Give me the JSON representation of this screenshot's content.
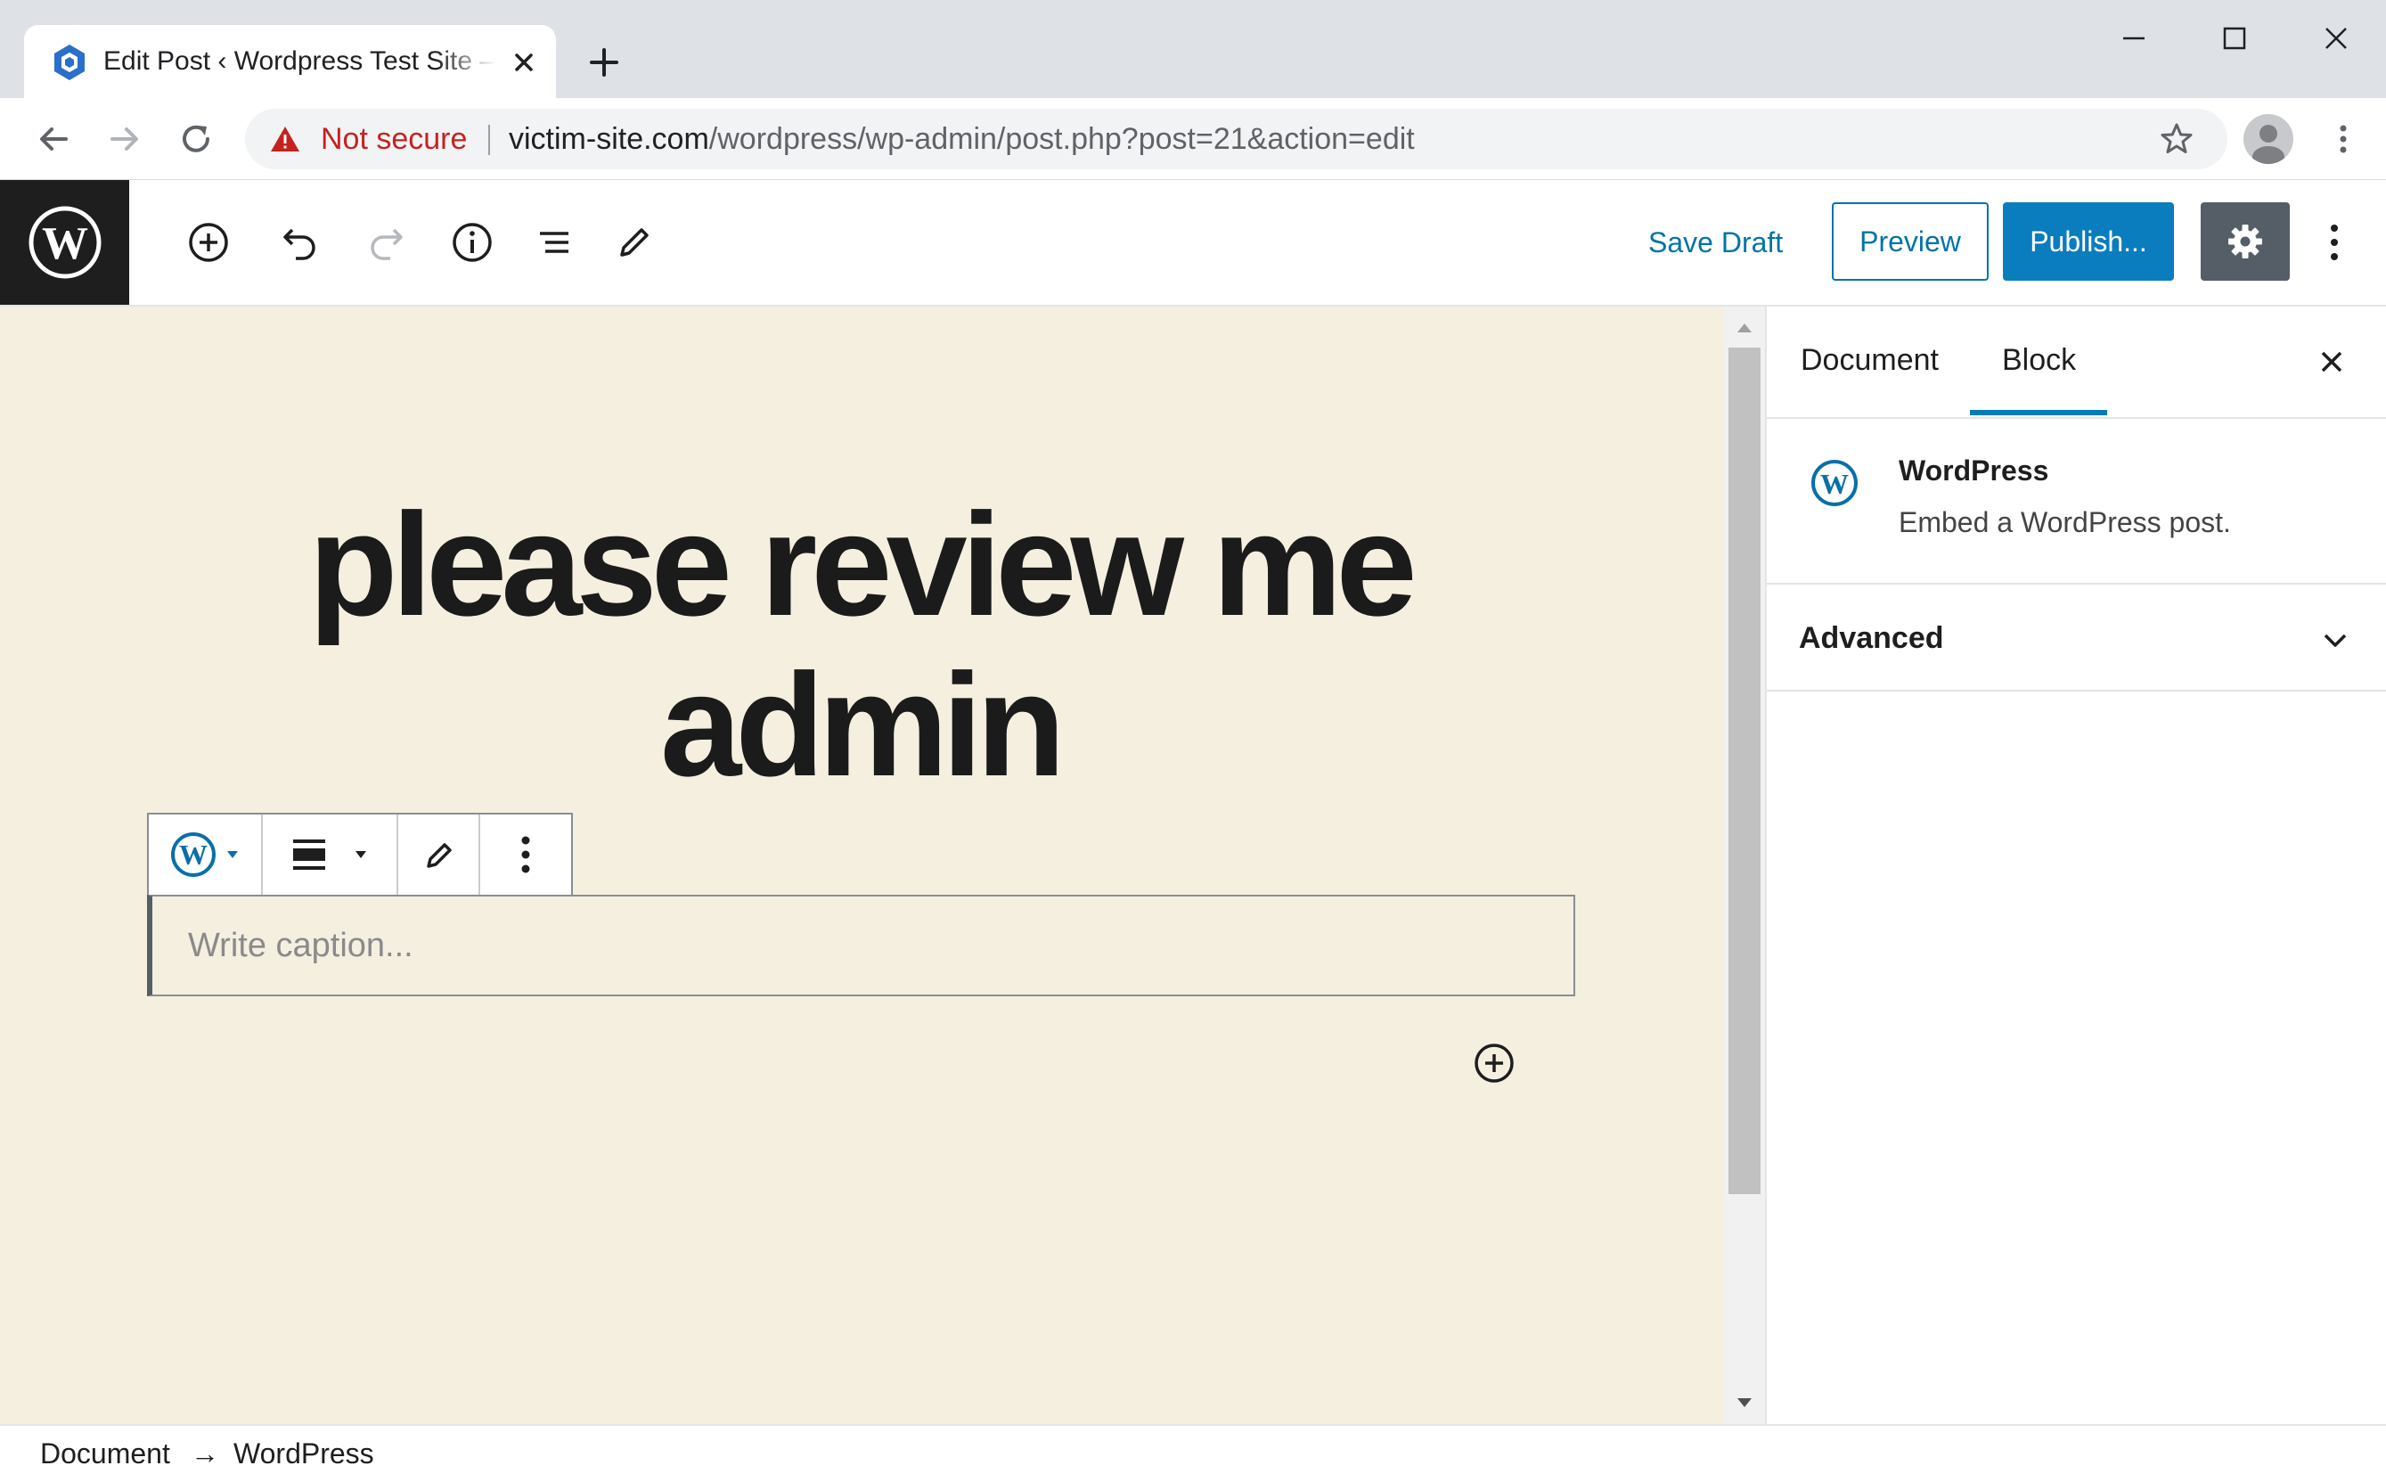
{
  "browser": {
    "tab_title": "Edit Post ‹ Wordpress Test Site — WordPress",
    "security_label": "Not secure",
    "url_host": "victim-site.com",
    "url_path": "/wordpress/wp-admin/post.php?post=21&action=edit"
  },
  "wp_toolbar": {
    "save_draft": "Save Draft",
    "preview": "Preview",
    "publish": "Publish..."
  },
  "post": {
    "title": "please review me admin",
    "caption_placeholder": "Write caption..."
  },
  "sidebar": {
    "tabs": [
      {
        "label": "Document",
        "active": false
      },
      {
        "label": "Block",
        "active": true
      }
    ],
    "block_card": {
      "title": "WordPress",
      "description": "Embed a WordPress post."
    },
    "panels": [
      {
        "label": "Advanced",
        "expanded": false
      }
    ]
  },
  "breadcrumb": {
    "items": [
      "Document",
      "WordPress"
    ],
    "separator": "→"
  },
  "colors": {
    "accent": "#0073aa",
    "canvas_bg": "#f5efe0",
    "warning": "#c5221f",
    "toolbar_dark": "#1e1e1e"
  },
  "icons": {
    "tab_favicon": "hexagon-logo-icon",
    "block_type": "wordpress-icon",
    "settings": "gear-icon"
  }
}
